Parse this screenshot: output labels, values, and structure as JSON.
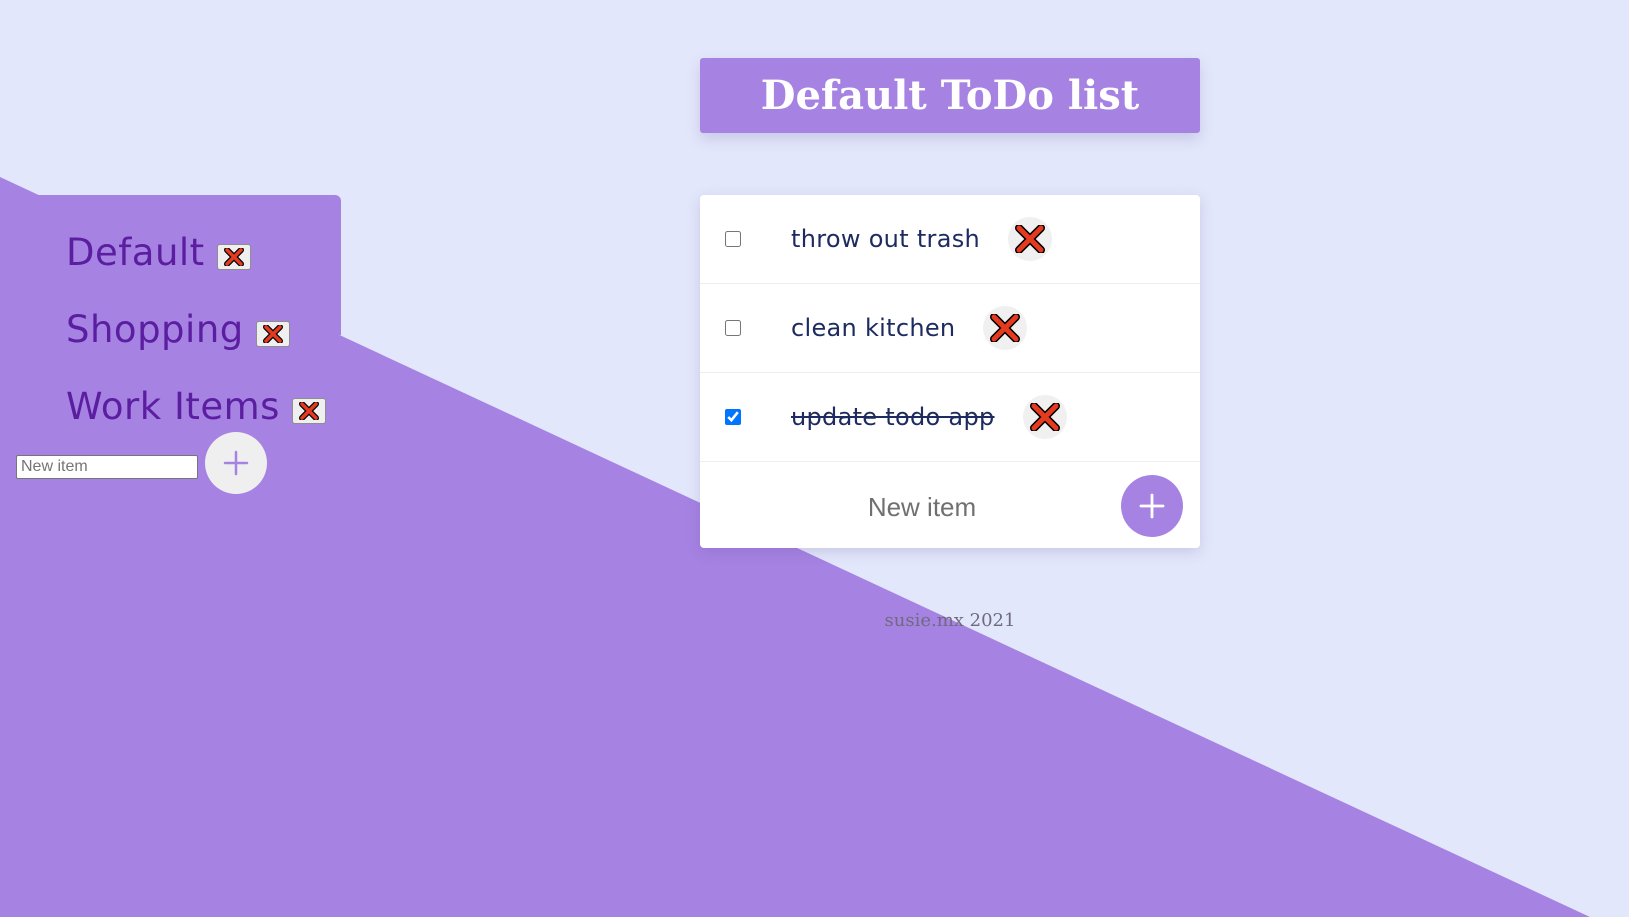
{
  "colors": {
    "background": "#e3e7fb",
    "accent": "#a683e2",
    "list_text": "#5c1ea0",
    "todo_text": "#1d2b60",
    "delete_red": "#e63a1e"
  },
  "sidebar": {
    "lists": [
      {
        "label": "Default",
        "delete_icon": "close-icon"
      },
      {
        "label": "Shopping",
        "delete_icon": "close-icon"
      },
      {
        "label": "Work Items",
        "delete_icon": "close-icon"
      }
    ],
    "new_item_placeholder": "New item",
    "add_icon": "plus-icon"
  },
  "header": {
    "title": "Default ToDo list"
  },
  "todos": [
    {
      "text": "throw out trash",
      "checked": false
    },
    {
      "text": "clean kitchen",
      "checked": false
    },
    {
      "text": "update todo app",
      "checked": true
    }
  ],
  "new_todo": {
    "placeholder": "New item",
    "add_icon": "plus-icon"
  },
  "footer": {
    "text": "susie.mx 2021"
  }
}
